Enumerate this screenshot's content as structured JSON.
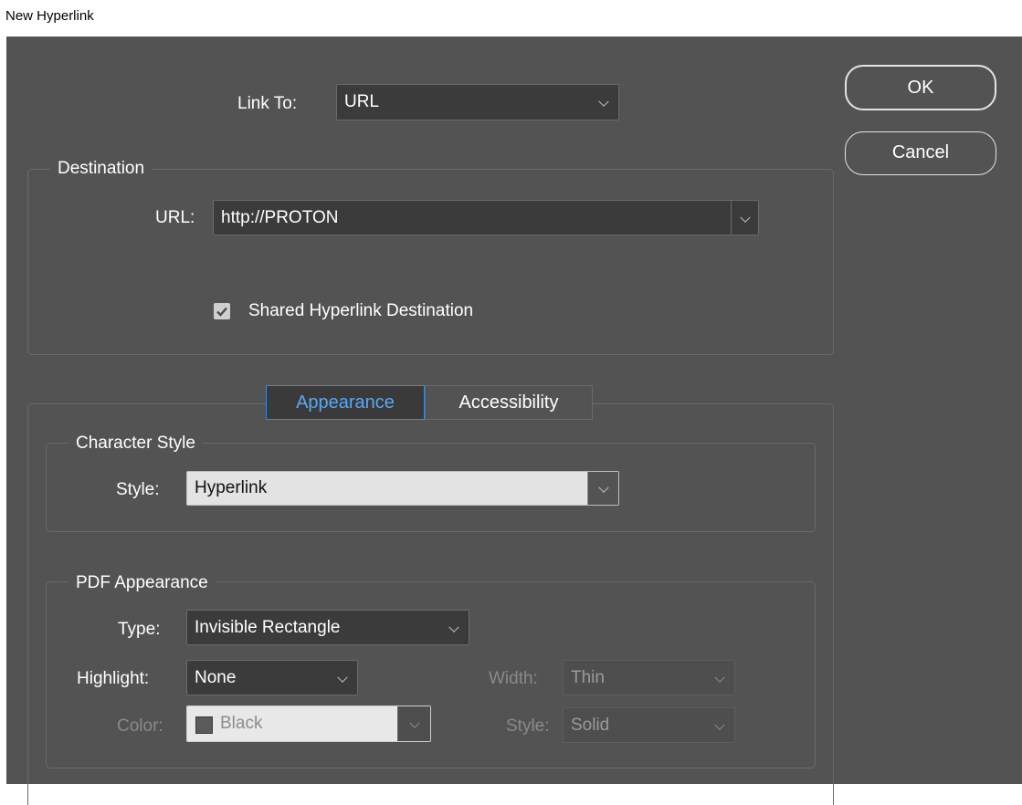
{
  "window": {
    "title": "New Hyperlink"
  },
  "buttons": {
    "ok": "OK",
    "cancel": "Cancel"
  },
  "link_to": {
    "label": "Link To:",
    "value": "URL"
  },
  "destination": {
    "legend": "Destination",
    "url_label": "URL:",
    "url_value": "http://PROTON",
    "shared_label": "Shared Hyperlink Destination",
    "shared_checked": true
  },
  "tabs": [
    {
      "label": "Appearance",
      "active": true
    },
    {
      "label": "Accessibility",
      "active": false
    }
  ],
  "character_style": {
    "legend": "Character Style",
    "style_label": "Style:",
    "style_value": "Hyperlink"
  },
  "pdf_appearance": {
    "legend": "PDF Appearance",
    "type_label": "Type:",
    "type_value": "Invisible Rectangle",
    "highlight_label": "Highlight:",
    "highlight_value": "None",
    "width_label": "Width:",
    "width_value": "Thin",
    "color_label": "Color:",
    "color_value": "Black",
    "style_label": "Style:",
    "style_value": "Solid"
  },
  "colors": {
    "dialog_bg": "#535353",
    "field_bg": "#3b3b3b",
    "accent": "#2d8ceb",
    "text": "#ffffff",
    "disabled_text": "#8a8a8a"
  }
}
